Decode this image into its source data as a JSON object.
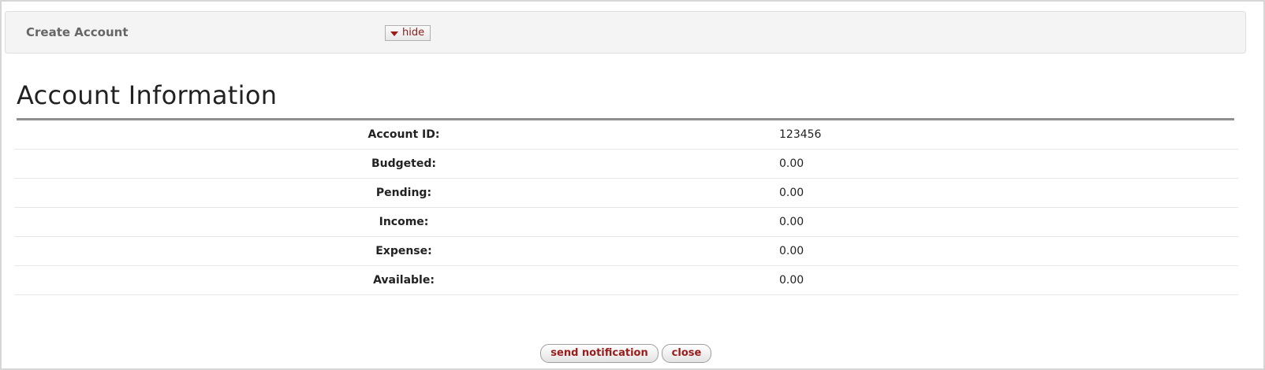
{
  "header": {
    "title": "Create Account",
    "toggle_label": "hide",
    "toggle_icon": "caret-down-icon"
  },
  "section": {
    "title": "Account Information"
  },
  "rows": [
    {
      "label": "Account ID:",
      "value": "123456"
    },
    {
      "label": "Budgeted:",
      "value": "0.00"
    },
    {
      "label": "Pending:",
      "value": "0.00"
    },
    {
      "label": "Income:",
      "value": "0.00"
    },
    {
      "label": "Expense:",
      "value": "0.00"
    },
    {
      "label": "Available:",
      "value": "0.00"
    }
  ],
  "buttons": {
    "send_notification": "send notification",
    "close": "close"
  },
  "colors": {
    "accent": "#9b1b1b",
    "bar_background": "#f4f4f4",
    "rule": "#8f8f8f"
  }
}
